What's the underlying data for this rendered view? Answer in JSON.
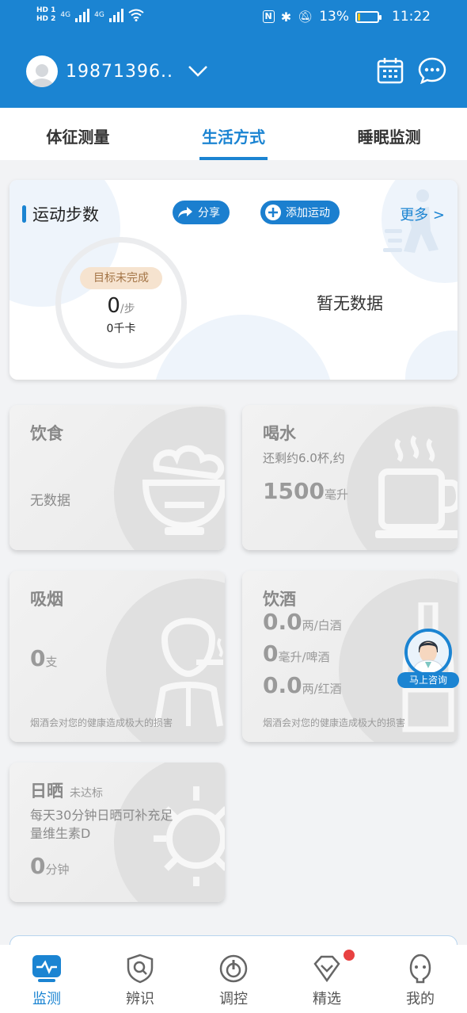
{
  "status_bar": {
    "hd1": "HD 1",
    "hd2": "HD 2",
    "net1": "4G",
    "net2": "4G",
    "battery_text": "13%",
    "battery_level": 0.13,
    "time": "11:22"
  },
  "header": {
    "user_name": "19871396..",
    "bg_color": "#1b84d2"
  },
  "tabs": [
    {
      "label": "体征测量",
      "active": false
    },
    {
      "label": "生活方式",
      "active": true
    },
    {
      "label": "睡眠监测",
      "active": false
    }
  ],
  "steps_card": {
    "title": "运动步数",
    "share_label": "分享",
    "add_label": "添加运动",
    "more_label": "更多 >",
    "goal_badge": "目标未完成",
    "steps_value": "0",
    "steps_unit": "/步",
    "calories": "0千卡",
    "no_data": "暂无数据"
  },
  "diet_card": {
    "title": "饮食",
    "value": "无数据"
  },
  "water_card": {
    "title": "喝水",
    "remaining": "还剩约6.0杯,约",
    "value": "1500",
    "unit": "毫升"
  },
  "smoke_card": {
    "title": "吸烟",
    "value": "0",
    "unit": "支",
    "footer": "烟酒会对您的健康造成极大的损害"
  },
  "alcohol_card": {
    "title": "饮酒",
    "rows": [
      {
        "value": "0.0",
        "unit": "两/白酒"
      },
      {
        "value": "0",
        "unit": "毫升/啤酒"
      },
      {
        "value": "0.0",
        "unit": "两/红酒"
      }
    ],
    "footer": "烟酒会对您的健康造成极大的损害"
  },
  "sun_card": {
    "title": "日晒",
    "status": "未达标",
    "desc1": "每天30分钟日晒可补充足",
    "desc2": "量维生素D",
    "value": "0",
    "unit": "分钟"
  },
  "consult": {
    "label": "马上咨询"
  },
  "navbar": [
    {
      "label": "监测",
      "icon": "monitor-icon",
      "active": true
    },
    {
      "label": "辨识",
      "icon": "identify-shield-icon",
      "active": false
    },
    {
      "label": "调控",
      "icon": "regulate-icon",
      "active": false
    },
    {
      "label": "精选",
      "icon": "featured-heart-icon",
      "active": false,
      "badge": true
    },
    {
      "label": "我的",
      "icon": "profile-icon",
      "active": false
    }
  ]
}
